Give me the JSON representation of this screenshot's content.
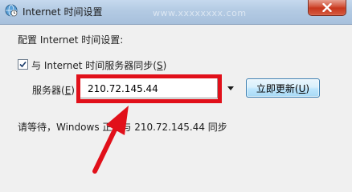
{
  "window": {
    "title": "Internet 时间设置",
    "watermark": "www.xxxxxxxx.com"
  },
  "dialog": {
    "config_label": "配置 Internet 时间设置:",
    "sync_checkbox": {
      "checked": true,
      "label_pre": "与 Internet 时间服务器同步(",
      "label_key": "S",
      "label_post": ")"
    },
    "server_label_pre": "服务器(",
    "server_label_key": "E",
    "server_label_post": ")",
    "server_value": "210.72.145.44",
    "update_button": {
      "label_pre": "立即更新(",
      "label_key": "U",
      "label_post": ")"
    },
    "status_text": "请等待，Windows 正在与 210.72.145.44 同步"
  },
  "icons": {
    "app": "clock-globe-icon",
    "close": "close-icon",
    "dropdown": "chevron-down-icon",
    "check": "checkmark-icon"
  },
  "colors": {
    "highlight": "#e1101a",
    "titlebar": "#b3cae3",
    "close_button": "#c7361d",
    "button_border": "#3c7fb1"
  }
}
